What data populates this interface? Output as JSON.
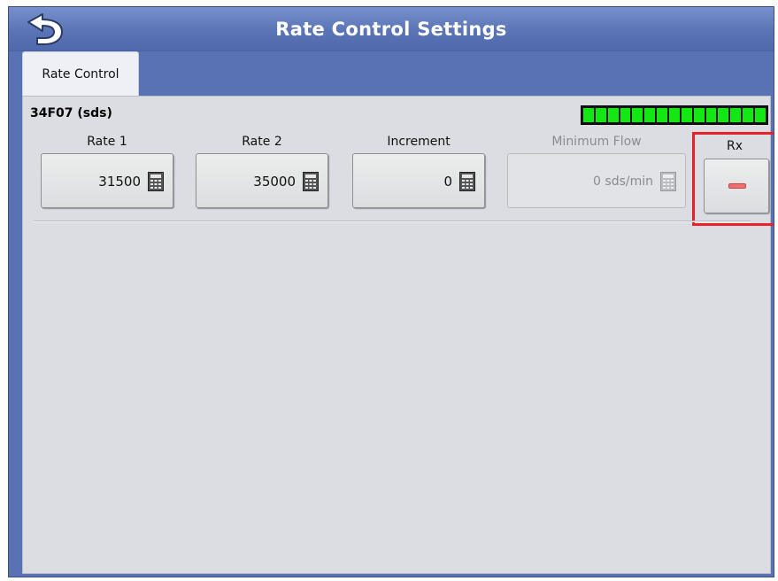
{
  "header": {
    "title": "Rate Control Settings",
    "back_icon": "undo-arrow-icon"
  },
  "tabs": [
    {
      "label": "Rate Control",
      "selected": true
    }
  ],
  "product": {
    "name": "34F07 (sds)",
    "level_indicator": {
      "segments": 15,
      "filled": 15,
      "color": "#14e814"
    }
  },
  "fields": [
    {
      "label": "Rate 1",
      "value": "31500",
      "icon": "calculator-icon",
      "enabled": true
    },
    {
      "label": "Rate 2",
      "value": "35000",
      "icon": "calculator-icon",
      "enabled": true
    },
    {
      "label": "Increment",
      "value": "0",
      "icon": "calculator-icon",
      "enabled": true
    },
    {
      "label": "Minimum Flow",
      "value": "0 sds/min",
      "icon": "calculator-icon",
      "enabled": false
    }
  ],
  "rx": {
    "label": "Rx",
    "state_icon": "minus-icon",
    "highlight_color": "#e8222a"
  },
  "colors": {
    "header_blue": "#5872b3",
    "panel_gray": "#dcdde3",
    "level_green": "#14e814"
  }
}
